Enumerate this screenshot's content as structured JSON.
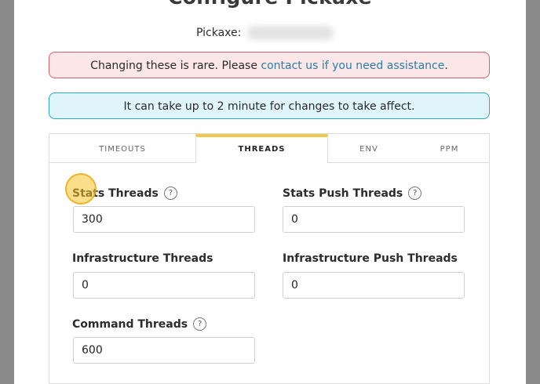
{
  "modal": {
    "title": "Configure Pickaxe",
    "pickaxe_label": "Pickaxe:"
  },
  "alerts": {
    "danger_text": "Changing these is rare. Please ",
    "danger_link": "contact us if you need assistance",
    "danger_suffix": ".",
    "info_text": "It can take up to 2 minute for changes to take affect."
  },
  "tabs": [
    {
      "label": "TIMEOUTS",
      "active": false
    },
    {
      "label": "THREADS",
      "active": true
    },
    {
      "label": "ENV",
      "active": false
    },
    {
      "label": "PPM",
      "active": false
    }
  ],
  "fields": {
    "stats_threads": {
      "label": "Stats Threads",
      "value": "300"
    },
    "stats_push_threads": {
      "label": "Stats Push Threads",
      "value": "0"
    },
    "infrastructure_threads": {
      "label": "Infrastructure Threads",
      "value": "0"
    },
    "infrastructure_push_threads": {
      "label": "Infrastructure Push Threads",
      "value": "0"
    },
    "command_threads": {
      "label": "Command Threads",
      "value": "600"
    }
  },
  "help_glyph": "?",
  "colors": {
    "active_tab_accent": "#f1c94a",
    "danger_border": "#d6606a",
    "info_border": "#2aa7c9",
    "link": "#2a7fa6"
  }
}
